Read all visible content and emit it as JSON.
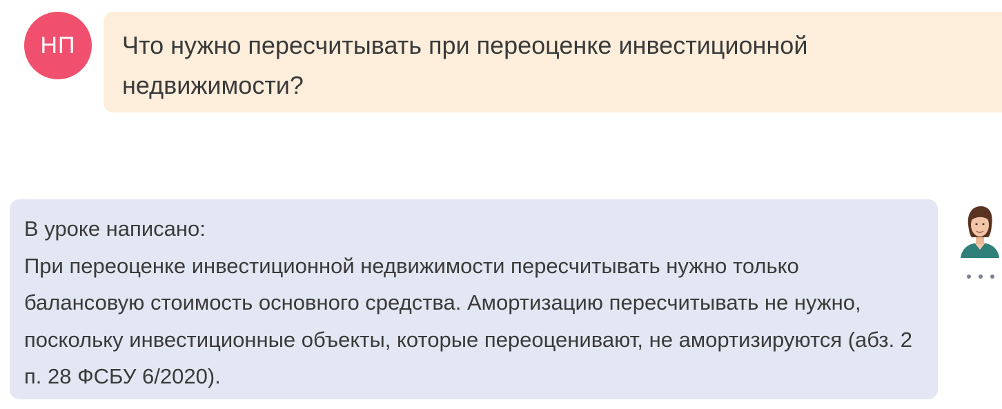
{
  "user_message": {
    "avatar_initials": "НП",
    "avatar_color": "#f0506e",
    "bubble_color": "#fdeedb",
    "text": "Что нужно пересчитывать при переоценке инвестиционной недвижимости?"
  },
  "bot_message": {
    "bubble_color": "#e2e7f3",
    "intro": "В уроке написано:",
    "body": "При переоценке инвестиционной недвижимости пересчитывать нужно только балансовую стоимость основного средства. Амортизацию пересчитывать не нужно, поскольку инвестиционные объекты, которые переоценивают, не амортизируются (абз. 2 п. 28 ФСБУ 6/2020).",
    "avatar_icon": "expert-avatar-photo",
    "more_icon": "more-dots-icon"
  }
}
